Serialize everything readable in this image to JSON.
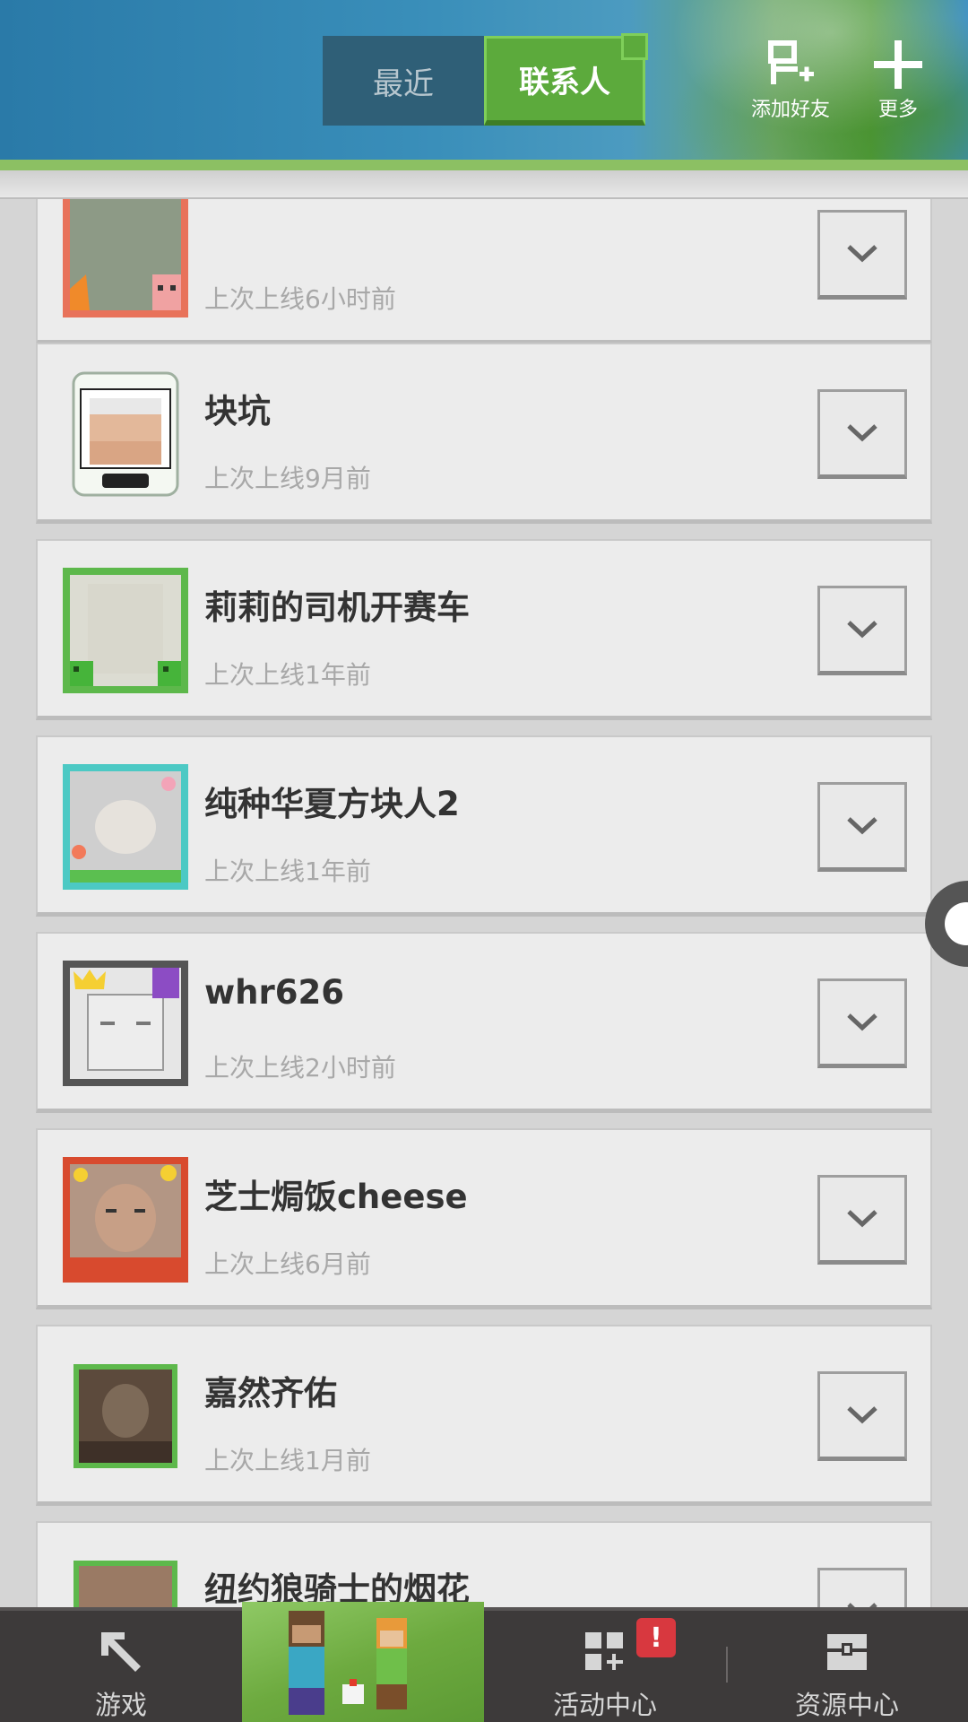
{
  "header": {
    "tabs": [
      {
        "label": "最近",
        "active": false
      },
      {
        "label": "联系人",
        "active": true
      }
    ],
    "add_friend_label": "添加好友",
    "more_label": "更多"
  },
  "contacts": [
    {
      "name": "",
      "status": "上次上线6小时前",
      "avatar_icon": "pig-frame-avatar"
    },
    {
      "name": "块坑",
      "status": "上次上线9月前",
      "avatar_icon": "phone-frame-avatar"
    },
    {
      "name": "莉莉的司机开赛车",
      "status": "上次上线1年前",
      "avatar_icon": "creeper-frame-avatar"
    },
    {
      "name": "纯种华夏方块人2",
      "status": "上次上线1年前",
      "avatar_icon": "flower-frame-avatar"
    },
    {
      "name": "whr626",
      "status": "上次上线2小时前",
      "avatar_icon": "crown-frame-avatar"
    },
    {
      "name": "芝士焗饭cheese",
      "status": "上次上线6月前",
      "avatar_icon": "festival-frame-avatar"
    },
    {
      "name": "嘉然齐佑",
      "status": "上次上线1月前",
      "avatar_icon": "green-frame-avatar"
    },
    {
      "name": "纽约狼骑士的烟花",
      "status": "",
      "avatar_icon": "green-frame-avatar"
    }
  ],
  "bottom_nav": {
    "game_label": "游戏",
    "activity_label": "活动中心",
    "activity_badge": "!",
    "resource_label": "资源中心"
  },
  "colors": {
    "accent_green": "#5caa3c",
    "header_blue": "#2f7aa8",
    "alert_red": "#d8383f"
  }
}
